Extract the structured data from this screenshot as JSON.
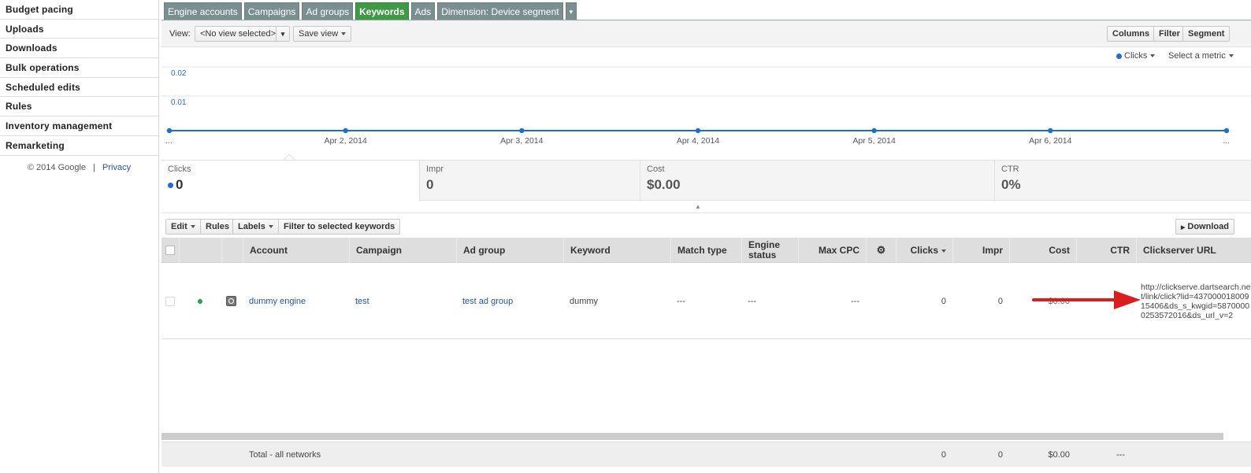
{
  "sidebar": {
    "items": [
      {
        "label": "Budget pacing"
      },
      {
        "label": "Uploads"
      },
      {
        "label": "Downloads"
      },
      {
        "label": "Bulk operations"
      },
      {
        "label": "Scheduled edits"
      },
      {
        "label": "Rules"
      },
      {
        "label": "Inventory management"
      },
      {
        "label": "Remarketing"
      }
    ],
    "footer": {
      "copyright": "© 2014 Google",
      "separator": "|",
      "privacy": "Privacy"
    }
  },
  "tabs": [
    {
      "label": "Engine accounts",
      "active": false
    },
    {
      "label": "Campaigns",
      "active": false
    },
    {
      "label": "Ad groups",
      "active": false
    },
    {
      "label": "Keywords",
      "active": true
    },
    {
      "label": "Ads",
      "active": false
    },
    {
      "label": "Dimension: Device segment",
      "active": false
    },
    {
      "label": "▾",
      "active": false
    }
  ],
  "toolbar": {
    "view_label": "View:",
    "view_value": "<No view selected>",
    "view_dropdown": "▾",
    "save_view": "Save view",
    "columns": "Columns",
    "filter": "Filter",
    "segment": "Segment"
  },
  "chart": {
    "metric_selected": "Clicks",
    "select_metric": "Select a metric",
    "colors": {
      "line": "#1f6fc5",
      "grid": "#e6e6e6"
    }
  },
  "chart_data": {
    "type": "line",
    "x": [
      "...",
      "Apr 2, 2014",
      "Apr 3, 2014",
      "Apr 4, 2014",
      "Apr 5, 2014",
      "Apr 6, 2014",
      "..."
    ],
    "series": [
      {
        "name": "Clicks",
        "values": [
          0,
          0,
          0,
          0,
          0,
          0,
          0
        ]
      }
    ],
    "yticks": [
      "0.02",
      "0.01"
    ],
    "ylim": [
      0,
      0.02
    ]
  },
  "summary": [
    {
      "label": "Clicks",
      "value": "0",
      "dot": true
    },
    {
      "label": "Impr",
      "value": "0",
      "dot": false
    },
    {
      "label": "Cost",
      "value": "$0.00",
      "dot": false
    },
    {
      "label": "CTR",
      "value": "0%",
      "dot": false
    }
  ],
  "table_toolbar": {
    "edit": "Edit",
    "rules": "Rules",
    "labels": "Labels",
    "filter_selected": "Filter to selected keywords",
    "download": "Download"
  },
  "table": {
    "headers": {
      "account": "Account",
      "campaign": "Campaign",
      "ad_group": "Ad group",
      "keyword": "Keyword",
      "match_type": "Match type",
      "engine_status_1": "Engine",
      "engine_status_2": "status",
      "max_cpc": "Max CPC",
      "clicks": "Clicks",
      "impr": "Impr",
      "cost": "Cost",
      "ctr": "CTR",
      "clickserver_url": "Clickserver URL"
    },
    "row": {
      "account": "dummy engine",
      "campaign": "test",
      "ad_group": "test ad group",
      "keyword": "dummy",
      "match_type": "---",
      "engine_status": "---",
      "max_cpc": "---",
      "clicks": "0",
      "impr": "0",
      "cost": "$0.00",
      "clickserver_url": "http://clickserve.dartsearch.net/link/click?lid=43700001800915406&ds_s_kwgid=58700000253572016&ds_url_v=2"
    },
    "footer": {
      "label": "Total - all networks",
      "clicks": "0",
      "impr": "0",
      "cost": "$0.00",
      "ctr": "---"
    }
  }
}
